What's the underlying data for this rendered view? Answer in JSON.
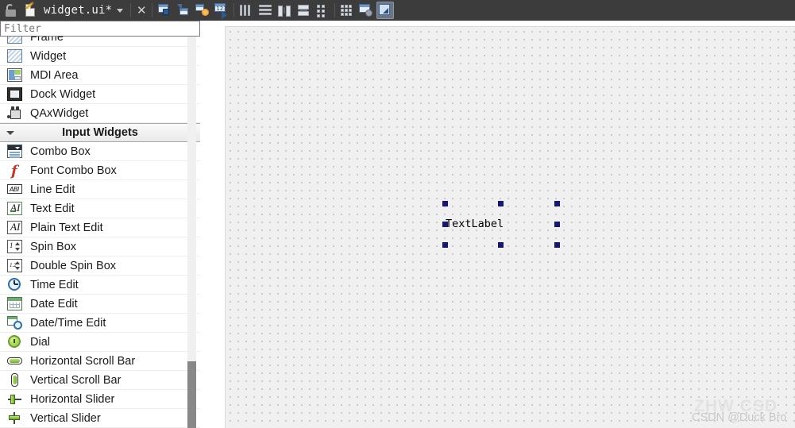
{
  "titlebar": {
    "lock_icon": "unlock-icon",
    "doc_icon": "document-edit-icon",
    "title": "widget.ui*",
    "dropdown_icon": "chevron-down-icon",
    "close_icon": "close-icon",
    "tools": [
      {
        "name": "edit-widgets-button",
        "icon": "edit-widgets-icon",
        "selected": false
      },
      {
        "name": "edit-signals-slots-button",
        "icon": "signals-slots-icon",
        "selected": false
      },
      {
        "name": "edit-buddies-button",
        "icon": "edit-buddies-icon",
        "selected": false
      },
      {
        "name": "edit-tab-order-button",
        "icon": "tab-order-icon",
        "selected": false
      },
      {
        "name": "layout-horizontally-button",
        "icon": "layout-horizontal-icon",
        "selected": false
      },
      {
        "name": "layout-vertically-button",
        "icon": "layout-vertical-icon",
        "selected": false
      },
      {
        "name": "layout-splitter-h-button",
        "icon": "splitter-horizontal-icon",
        "selected": false
      },
      {
        "name": "layout-splitter-v-button",
        "icon": "splitter-vertical-icon",
        "selected": false
      },
      {
        "name": "layout-form-button",
        "icon": "layout-form-icon",
        "selected": false
      },
      {
        "name": "layout-grid-button",
        "icon": "layout-grid-icon",
        "selected": false
      },
      {
        "name": "break-layout-button",
        "icon": "break-layout-icon",
        "selected": false
      },
      {
        "name": "adjust-size-button",
        "icon": "adjust-size-icon",
        "selected": true
      }
    ]
  },
  "sidebar": {
    "filter": {
      "value": "",
      "placeholder": "Filter"
    },
    "items": [
      {
        "label": "Frame",
        "icon": "frame-icon",
        "type": "widget"
      },
      {
        "label": "Widget",
        "icon": "widget-icon",
        "type": "widget"
      },
      {
        "label": "MDI Area",
        "icon": "mdi-area-icon",
        "type": "widget"
      },
      {
        "label": "Dock Widget",
        "icon": "dock-widget-icon",
        "type": "widget"
      },
      {
        "label": "QAxWidget",
        "icon": "qax-widget-icon",
        "type": "widget"
      },
      {
        "label": "Input Widgets",
        "icon": "chevron-down-icon",
        "type": "category"
      },
      {
        "label": "Combo Box",
        "icon": "combo-box-icon",
        "type": "widget"
      },
      {
        "label": "Font Combo Box",
        "icon": "font-combo-box-icon",
        "type": "widget"
      },
      {
        "label": "Line Edit",
        "icon": "line-edit-icon",
        "type": "widget"
      },
      {
        "label": "Text Edit",
        "icon": "text-edit-icon",
        "type": "widget"
      },
      {
        "label": "Plain Text Edit",
        "icon": "plain-text-edit-icon",
        "type": "widget"
      },
      {
        "label": "Spin Box",
        "icon": "spin-box-icon",
        "type": "widget"
      },
      {
        "label": "Double Spin Box",
        "icon": "double-spin-box-icon",
        "type": "widget"
      },
      {
        "label": "Time Edit",
        "icon": "time-edit-icon",
        "type": "widget"
      },
      {
        "label": "Date Edit",
        "icon": "date-edit-icon",
        "type": "widget"
      },
      {
        "label": "Date/Time Edit",
        "icon": "date-time-edit-icon",
        "type": "widget"
      },
      {
        "label": "Dial",
        "icon": "dial-icon",
        "type": "widget"
      },
      {
        "label": "Horizontal Scroll Bar",
        "icon": "h-scroll-bar-icon",
        "type": "widget"
      },
      {
        "label": "Vertical Scroll Bar",
        "icon": "v-scroll-bar-icon",
        "type": "widget"
      },
      {
        "label": "Horizontal Slider",
        "icon": "h-slider-icon",
        "type": "widget"
      },
      {
        "label": "Vertical Slider",
        "icon": "v-slider-icon",
        "type": "widget"
      }
    ],
    "scrollbar": {
      "thumb_top_pct": 83,
      "thumb_height_pct": 17
    }
  },
  "canvas": {
    "selected_widget": {
      "name": "text-label",
      "text": "TextLabel",
      "selected": true,
      "handle_count": 8,
      "handle_color": "#161673"
    },
    "watermark_back": "ZHW CSD",
    "watermark_front": "CSDN @Duck Bro"
  }
}
